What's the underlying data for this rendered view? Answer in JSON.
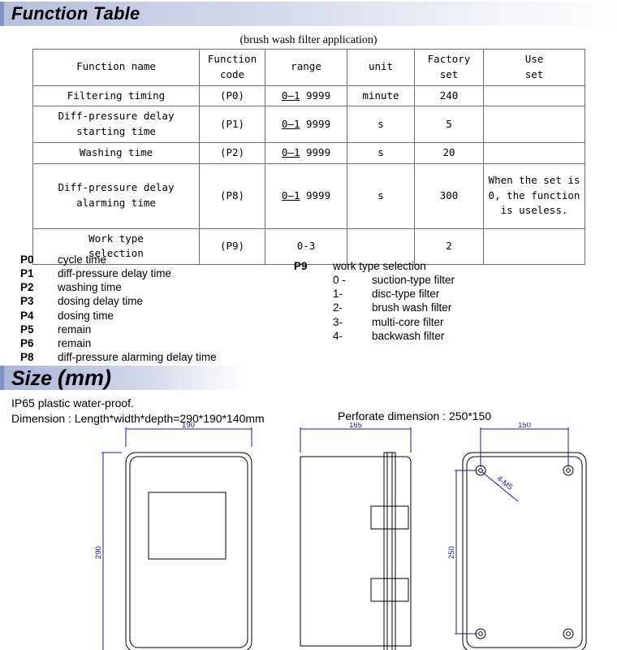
{
  "sections": {
    "function_table_title": "Function Table",
    "size_title": "Size",
    "size_title_unit": "(mm)"
  },
  "table": {
    "caption": "(brush wash filter application)",
    "headers": [
      "Function name",
      "Function code",
      "range",
      "unit",
      "Factory set",
      "Use set"
    ],
    "headers_lines": {
      "function_name": "Function name",
      "function_code_l1": "Function",
      "function_code_l2": "code",
      "range": "range",
      "unit": "unit",
      "factory_l1": "Factory",
      "factory_l2": "set",
      "use_l1": "Use",
      "use_l2": "set"
    },
    "rows": [
      {
        "name_l1": "Filtering timing",
        "name_l2": "",
        "code": "(P0)",
        "range_pre": "0—1",
        "range_post": "9999",
        "unit": "minute",
        "factory": "240",
        "use": ""
      },
      {
        "name_l1": "Diff-pressure delay",
        "name_l2": "starting time",
        "code": "(P1)",
        "range_pre": "0—1",
        "range_post": "9999",
        "unit": "s",
        "factory": "5",
        "use": ""
      },
      {
        "name_l1": "Washing time",
        "name_l2": "",
        "code": "(P2)",
        "range_pre": "0—1",
        "range_post": "9999",
        "unit": "s",
        "factory": "20",
        "use": ""
      },
      {
        "name_l1": "Diff-pressure delay",
        "name_l2": "alarming time",
        "code": "(P8)",
        "range_pre": "0—1",
        "range_post": "9999",
        "unit": "s",
        "factory": "300",
        "use": "When the set is 0, the function is useless."
      },
      {
        "name_l1": "Work type",
        "name_l2": "selection",
        "code": "(P9)",
        "range_pre": "",
        "range_post": "0-3",
        "unit": "",
        "factory": "2",
        "use": ""
      }
    ]
  },
  "legend_left": [
    {
      "code": "P0",
      "desc": "cycle time"
    },
    {
      "code": "P1",
      "desc": "diff-pressure delay time"
    },
    {
      "code": "P2",
      "desc": "washing time"
    },
    {
      "code": "P3",
      "desc": "dosing delay time"
    },
    {
      "code": "P4",
      "desc": "dosing time"
    },
    {
      "code": "P5",
      "desc": "remain"
    },
    {
      "code": "P6",
      "desc": "remain"
    },
    {
      "code": "P8",
      "desc": "diff-pressure alarming delay time"
    }
  ],
  "legend_right": {
    "code": "P9",
    "desc": "work type selection",
    "options": [
      {
        "value": "0 -",
        "label": "suction-type filter"
      },
      {
        "value": "1-",
        "label": "disc-type filter"
      },
      {
        "value": "2-",
        "label": "brush wash filter"
      },
      {
        "value": "3-",
        "label": "multi-core filter"
      },
      {
        "value": "4-",
        "label": "backwash filter"
      }
    ]
  },
  "size_notes": {
    "line1": "IP65 plastic water-proof.",
    "line2": "Dimension : Length*width*depth=290*190*140mm",
    "perforate": "Perforate dimension : 250*150"
  },
  "drawings": {
    "front": {
      "width_dim": "190",
      "height_dim": "290"
    },
    "side": {
      "width_dim": "165"
    },
    "rear": {
      "width_dim": "150",
      "height_dim": "250",
      "callout": "4-M5"
    }
  },
  "colors": {
    "banner_accent": "#8193c4",
    "dimension_line": "#1a1ab4",
    "part_line": "#000000",
    "table_border": "#6f6f6f"
  }
}
